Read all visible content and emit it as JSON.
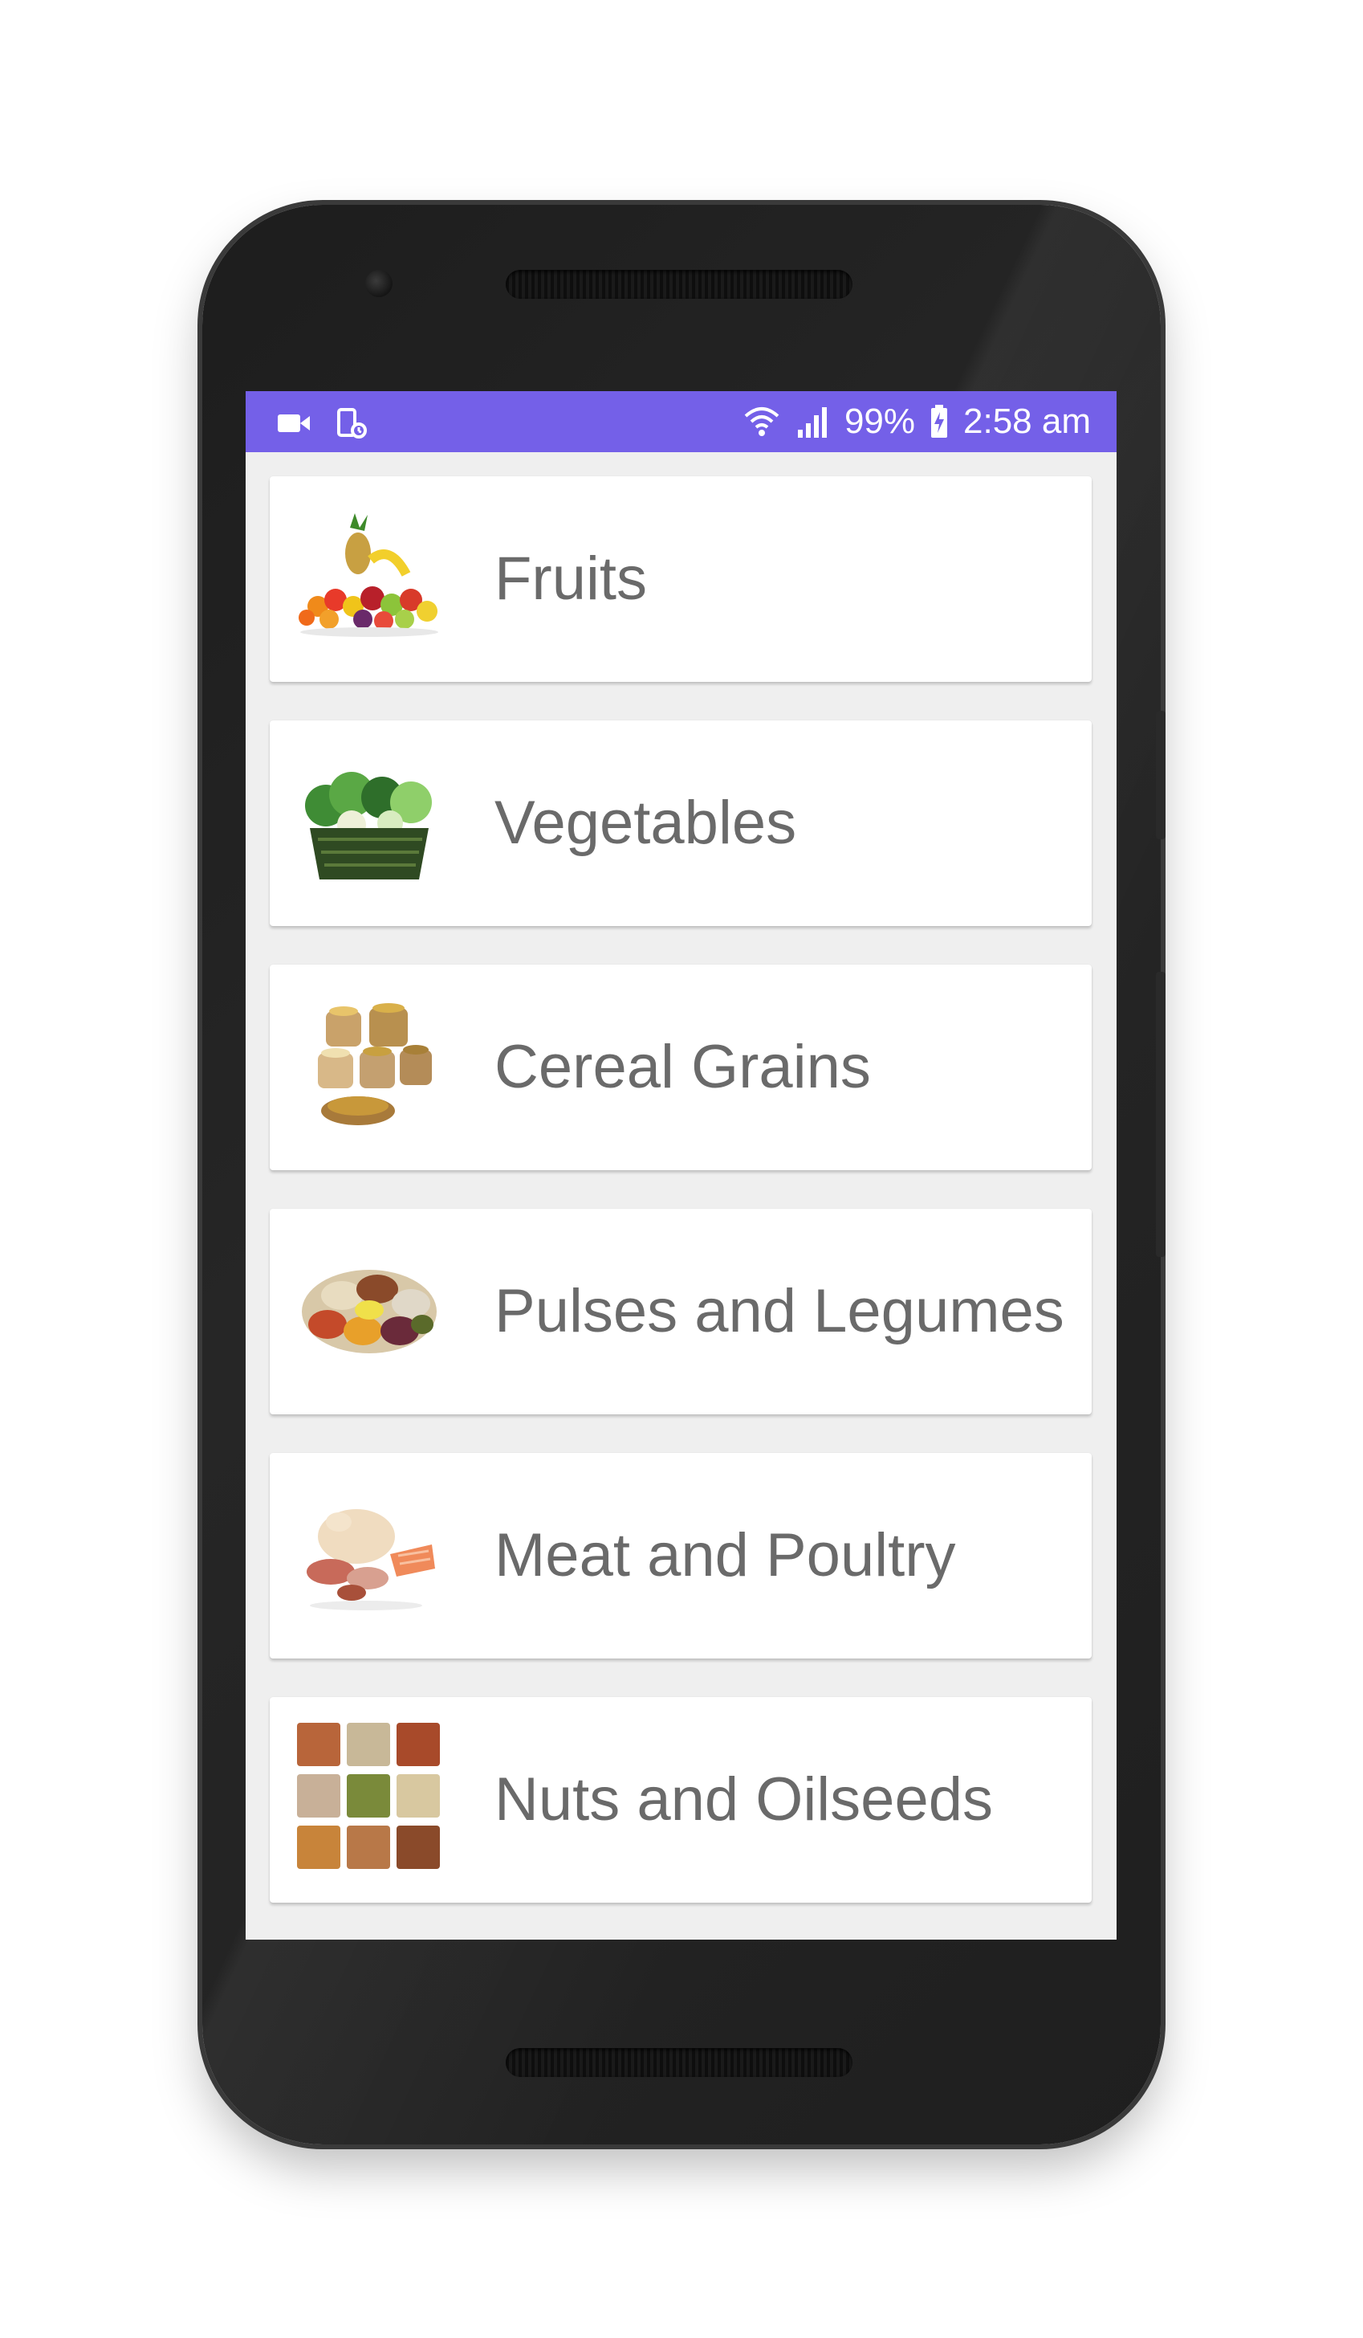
{
  "status_bar": {
    "battery": "99%",
    "time": "2:58 am",
    "color": "#7460e8",
    "left_icons": [
      "video-camera-icon",
      "screen-rotation-icon"
    ],
    "right_icons": [
      "wifi-icon",
      "signal-icon",
      "battery-charging-icon"
    ]
  },
  "categories": [
    {
      "label": "Fruits",
      "icon": "fruits-image"
    },
    {
      "label": "Vegetables",
      "icon": "vegetables-image"
    },
    {
      "label": "Cereal Grains",
      "icon": "cereal-grains-image"
    },
    {
      "label": "Pulses and Legumes",
      "icon": "pulses-legumes-image"
    },
    {
      "label": "Meat and Poultry",
      "icon": "meat-poultry-image"
    },
    {
      "label": "Nuts and Oilseeds",
      "icon": "nuts-oilseeds-image"
    }
  ]
}
